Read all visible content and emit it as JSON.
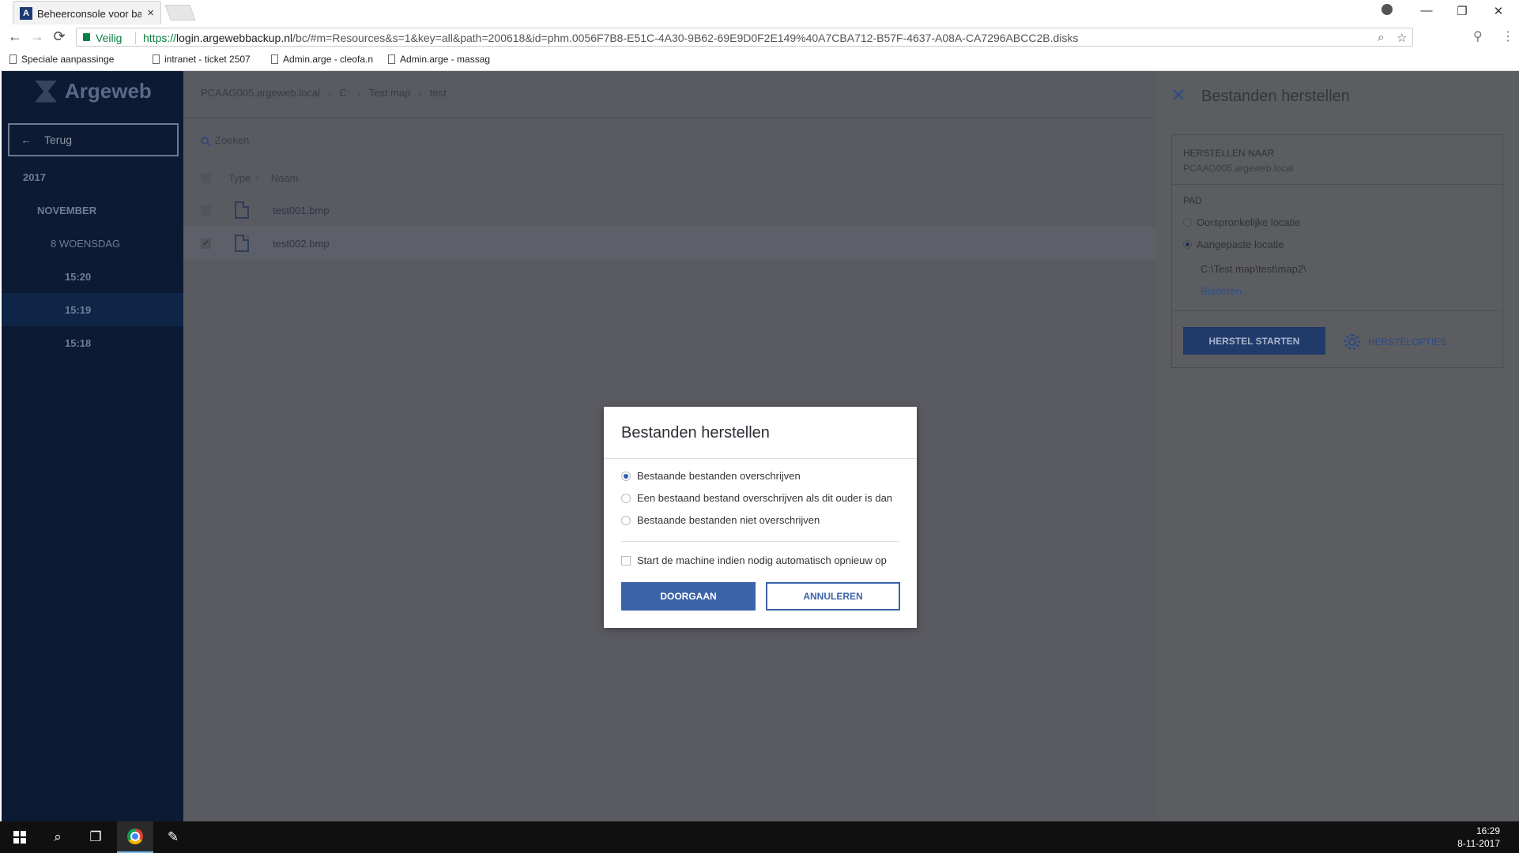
{
  "browser": {
    "tab_title": "Beheerconsole voor back",
    "tab_close": "×",
    "favicon_letter": "A",
    "secure_label": "Veilig",
    "url_proto": "https://",
    "url_host": "login.argewebbackup.nl",
    "url_rest": "/bc/#m=Resources&s=1&key=all&path=200618&id=phm.0056F7B8-E51C-4A30-9B62-69E9D0F2E149%40A7CBA712-B57F-4637-A08A-CA7296ABCC2B.disks",
    "bookmarks": [
      "Speciale aanpassinge",
      "intranet - ticket 2507",
      "Admin.arge - cleofa.n",
      "Admin.arge - massag"
    ],
    "icons": [
      "back-icon",
      "forward-icon",
      "reload-icon",
      "lock-icon",
      "zoom-icon",
      "star-icon",
      "extension-icon",
      "menu-icon",
      "profile-icon",
      "minimize-icon",
      "restore-icon",
      "close-icon"
    ],
    "glyphs": {
      "back": "←",
      "forward": "→",
      "reload": "⟳",
      "zoom": "⌕",
      "star": "☆",
      "ext": "⚲",
      "menu": "⋮",
      "minimize": "—",
      "restore": "❐",
      "close": "✕"
    }
  },
  "sidebar": {
    "logo": "Argeweb",
    "back_label": "Terug",
    "back_arrow": "←",
    "items": [
      {
        "label": "2017"
      },
      {
        "label": "NOVEMBER"
      },
      {
        "label": "8 WOENSDAG"
      },
      {
        "label": "15:20"
      },
      {
        "label": "15:19",
        "active": true
      },
      {
        "label": "15:18"
      }
    ]
  },
  "main": {
    "breadcrumb": [
      "PCAAG005.argeweb.local",
      "C:",
      "Test map",
      "test"
    ],
    "breadcrumb_sep": "›",
    "search_placeholder": "Zoeken",
    "col_type": "Type",
    "sort_arrow": "↑",
    "col_name": "Naam",
    "files": [
      {
        "name": "test001.bmp",
        "selected": false
      },
      {
        "name": "test002.bmp",
        "selected": true
      }
    ],
    "check_glyph": "✓"
  },
  "panel": {
    "close_glyph": "✕",
    "title": "Bestanden herstellen",
    "restore_to_label": "HERSTELLEN NAAR",
    "restore_to_value": "PCAAG005.argeweb.local",
    "path_label": "PAD",
    "option_original": "Oorspronkelijke locatie",
    "option_custom": "Aangepaste locatie",
    "custom_path": "C:\\Test map\\test\\map2\\",
    "browse": "Bladeren...",
    "start_button": "HERSTEL STARTEN",
    "options_button": "HERSTELOPTIES"
  },
  "modal": {
    "title": "Bestanden herstellen",
    "options": [
      {
        "label": "Bestaande bestanden overschrijven",
        "selected": true
      },
      {
        "label": "Een bestaand bestand overschrijven als dit ouder is dan",
        "selected": false
      },
      {
        "label": "Bestaande bestanden niet overschrijven",
        "selected": false
      }
    ],
    "restart_label": "Start de machine indien nodig automatisch opnieuw op",
    "continue_button": "DOORGAAN",
    "cancel_button": "ANNULEREN"
  },
  "taskbar": {
    "time": "16:29",
    "date": "8-11-2017",
    "search_glyph": "⌕",
    "taskview_glyph": "❐",
    "app_glyph": "✎"
  },
  "colors": {
    "sidebar_bg": "#0c1a34",
    "overlay_gray": "#5a5b61",
    "primary_blue": "#3b64a8"
  }
}
